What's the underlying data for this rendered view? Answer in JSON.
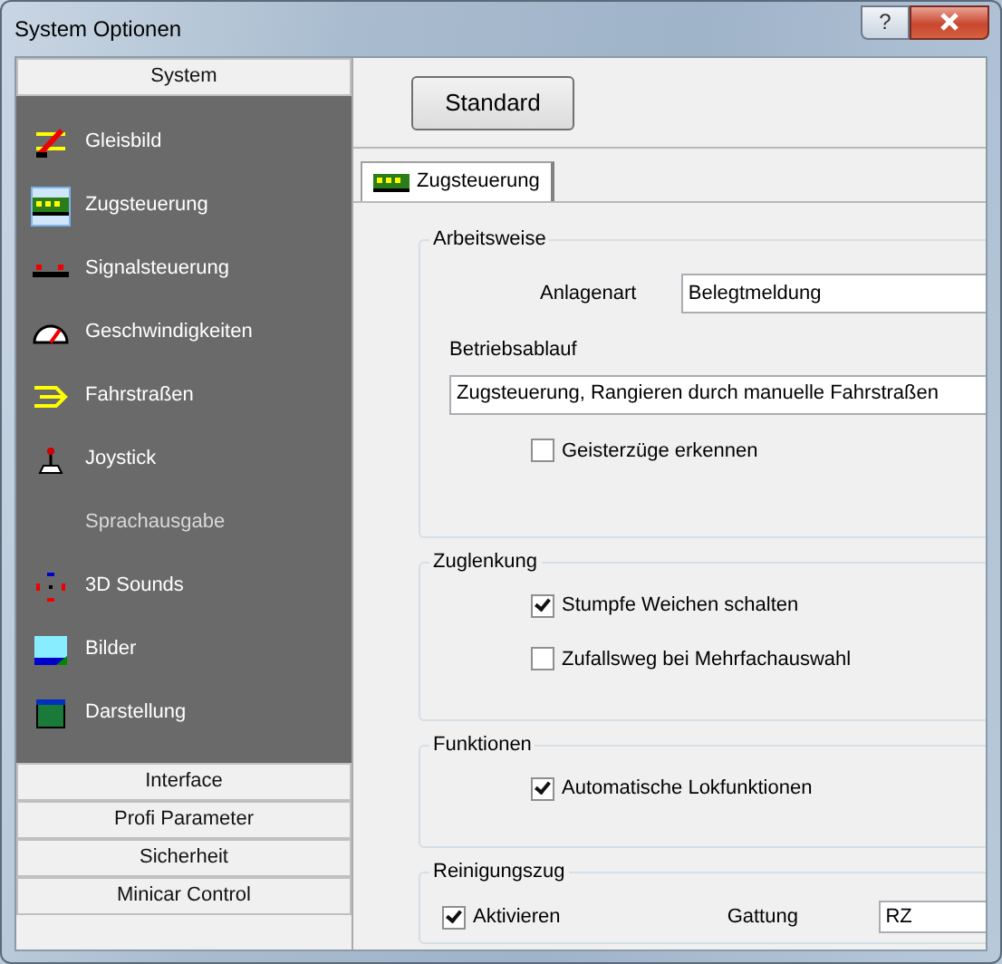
{
  "window": {
    "title": "System Optionen",
    "help_button": "?"
  },
  "sidebar": {
    "sections": [
      {
        "label": "System",
        "expanded": true,
        "items": [
          {
            "label": "Gleisbild",
            "kind": "track",
            "selected": false
          },
          {
            "label": "Zugsteuerung",
            "kind": "train",
            "selected": true
          },
          {
            "label": "Signalsteuerung",
            "kind": "signal",
            "selected": false
          },
          {
            "label": "Geschwindigkeiten",
            "kind": "gauge",
            "selected": false
          },
          {
            "label": "Fahrstraßen",
            "kind": "route",
            "selected": false
          },
          {
            "label": "Joystick",
            "kind": "joystick",
            "selected": false
          },
          {
            "label": "Sprachausgabe",
            "kind": "none",
            "selected": false
          },
          {
            "label": "3D Sounds",
            "kind": "sound",
            "selected": false
          },
          {
            "label": "Bilder",
            "kind": "image",
            "selected": false
          },
          {
            "label": "Darstellung",
            "kind": "display",
            "selected": false
          }
        ]
      },
      {
        "label": "Interface",
        "expanded": false
      },
      {
        "label": "Profi Parameter",
        "expanded": false
      },
      {
        "label": "Sicherheit",
        "expanded": false
      },
      {
        "label": "Minicar Control",
        "expanded": false
      }
    ]
  },
  "standard_button": "Standard",
  "tabs": [
    {
      "label": "Zugsteuerung",
      "selected": true
    }
  ],
  "groups": [
    {
      "title": "Arbeitsweise",
      "rows": [
        {
          "kind": "select",
          "label": "Anlagenart",
          "value": "Belegtmeldung"
        },
        {
          "kind": "text",
          "label": "Betriebsablauf",
          "value": "Zugsteuerung, Rangieren durch manuelle Fahrstraßen"
        },
        {
          "kind": "checkbox",
          "label": "Geisterzüge erkennen",
          "checked": false
        }
      ]
    },
    {
      "title": "Zuglenkung",
      "rows": [
        {
          "kind": "checkbox",
          "label": "Stumpfe Weichen schalten",
          "checked": true
        },
        {
          "kind": "checkbox",
          "label": "Zufallsweg bei Mehrfachauswahl",
          "checked": false
        }
      ]
    },
    {
      "title": "Funktionen",
      "rows": [
        {
          "kind": "checkbox",
          "label": "Automatische Lokfunktionen",
          "checked": true
        }
      ]
    },
    {
      "title": "Reinigungszug",
      "rows": [
        {
          "kind": "checkbox_field",
          "label": "Aktivieren",
          "checked": true,
          "field_label": "Gattung",
          "value": "RZ"
        }
      ]
    }
  ]
}
